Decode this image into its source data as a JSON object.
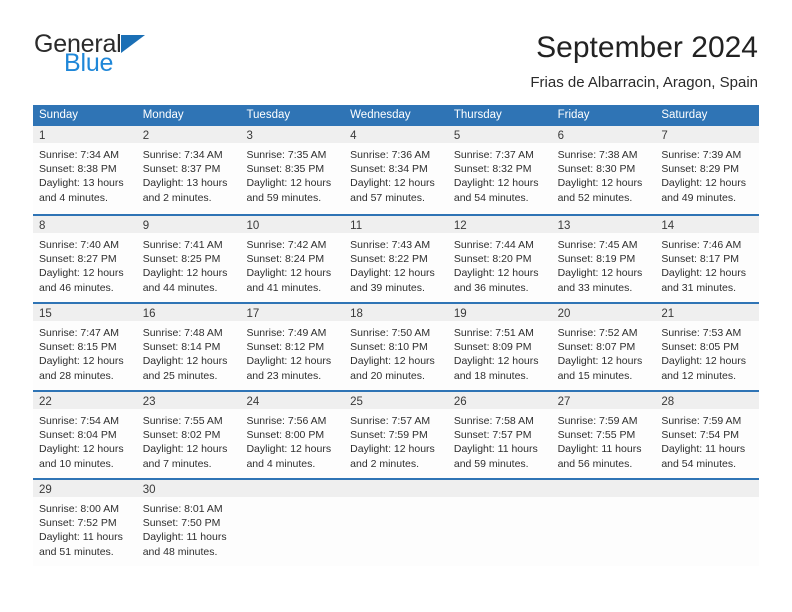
{
  "brand": {
    "name_primary": "General",
    "name_secondary": "Blue",
    "triangle_icon": "triangle-icon",
    "accent_color": "#1f87d8"
  },
  "header": {
    "title": "September 2024",
    "location": "Frias de Albarracin, Aragon, Spain"
  },
  "theme": {
    "header_blue": "#2f74b5",
    "daynum_band": "#efefef",
    "text": "#2e2e2e"
  },
  "calendar": {
    "weekday_headers": [
      "Sunday",
      "Monday",
      "Tuesday",
      "Wednesday",
      "Thursday",
      "Friday",
      "Saturday"
    ],
    "weeks": [
      [
        {
          "day": "1",
          "sunrise": "Sunrise: 7:34 AM",
          "sunset": "Sunset: 8:38 PM",
          "daylight_line1": "Daylight: 13 hours",
          "daylight_line2": "and 4 minutes."
        },
        {
          "day": "2",
          "sunrise": "Sunrise: 7:34 AM",
          "sunset": "Sunset: 8:37 PM",
          "daylight_line1": "Daylight: 13 hours",
          "daylight_line2": "and 2 minutes."
        },
        {
          "day": "3",
          "sunrise": "Sunrise: 7:35 AM",
          "sunset": "Sunset: 8:35 PM",
          "daylight_line1": "Daylight: 12 hours",
          "daylight_line2": "and 59 minutes."
        },
        {
          "day": "4",
          "sunrise": "Sunrise: 7:36 AM",
          "sunset": "Sunset: 8:34 PM",
          "daylight_line1": "Daylight: 12 hours",
          "daylight_line2": "and 57 minutes."
        },
        {
          "day": "5",
          "sunrise": "Sunrise: 7:37 AM",
          "sunset": "Sunset: 8:32 PM",
          "daylight_line1": "Daylight: 12 hours",
          "daylight_line2": "and 54 minutes."
        },
        {
          "day": "6",
          "sunrise": "Sunrise: 7:38 AM",
          "sunset": "Sunset: 8:30 PM",
          "daylight_line1": "Daylight: 12 hours",
          "daylight_line2": "and 52 minutes."
        },
        {
          "day": "7",
          "sunrise": "Sunrise: 7:39 AM",
          "sunset": "Sunset: 8:29 PM",
          "daylight_line1": "Daylight: 12 hours",
          "daylight_line2": "and 49 minutes."
        }
      ],
      [
        {
          "day": "8",
          "sunrise": "Sunrise: 7:40 AM",
          "sunset": "Sunset: 8:27 PM",
          "daylight_line1": "Daylight: 12 hours",
          "daylight_line2": "and 46 minutes."
        },
        {
          "day": "9",
          "sunrise": "Sunrise: 7:41 AM",
          "sunset": "Sunset: 8:25 PM",
          "daylight_line1": "Daylight: 12 hours",
          "daylight_line2": "and 44 minutes."
        },
        {
          "day": "10",
          "sunrise": "Sunrise: 7:42 AM",
          "sunset": "Sunset: 8:24 PM",
          "daylight_line1": "Daylight: 12 hours",
          "daylight_line2": "and 41 minutes."
        },
        {
          "day": "11",
          "sunrise": "Sunrise: 7:43 AM",
          "sunset": "Sunset: 8:22 PM",
          "daylight_line1": "Daylight: 12 hours",
          "daylight_line2": "and 39 minutes."
        },
        {
          "day": "12",
          "sunrise": "Sunrise: 7:44 AM",
          "sunset": "Sunset: 8:20 PM",
          "daylight_line1": "Daylight: 12 hours",
          "daylight_line2": "and 36 minutes."
        },
        {
          "day": "13",
          "sunrise": "Sunrise: 7:45 AM",
          "sunset": "Sunset: 8:19 PM",
          "daylight_line1": "Daylight: 12 hours",
          "daylight_line2": "and 33 minutes."
        },
        {
          "day": "14",
          "sunrise": "Sunrise: 7:46 AM",
          "sunset": "Sunset: 8:17 PM",
          "daylight_line1": "Daylight: 12 hours",
          "daylight_line2": "and 31 minutes."
        }
      ],
      [
        {
          "day": "15",
          "sunrise": "Sunrise: 7:47 AM",
          "sunset": "Sunset: 8:15 PM",
          "daylight_line1": "Daylight: 12 hours",
          "daylight_line2": "and 28 minutes."
        },
        {
          "day": "16",
          "sunrise": "Sunrise: 7:48 AM",
          "sunset": "Sunset: 8:14 PM",
          "daylight_line1": "Daylight: 12 hours",
          "daylight_line2": "and 25 minutes."
        },
        {
          "day": "17",
          "sunrise": "Sunrise: 7:49 AM",
          "sunset": "Sunset: 8:12 PM",
          "daylight_line1": "Daylight: 12 hours",
          "daylight_line2": "and 23 minutes."
        },
        {
          "day": "18",
          "sunrise": "Sunrise: 7:50 AM",
          "sunset": "Sunset: 8:10 PM",
          "daylight_line1": "Daylight: 12 hours",
          "daylight_line2": "and 20 minutes."
        },
        {
          "day": "19",
          "sunrise": "Sunrise: 7:51 AM",
          "sunset": "Sunset: 8:09 PM",
          "daylight_line1": "Daylight: 12 hours",
          "daylight_line2": "and 18 minutes."
        },
        {
          "day": "20",
          "sunrise": "Sunrise: 7:52 AM",
          "sunset": "Sunset: 8:07 PM",
          "daylight_line1": "Daylight: 12 hours",
          "daylight_line2": "and 15 minutes."
        },
        {
          "day": "21",
          "sunrise": "Sunrise: 7:53 AM",
          "sunset": "Sunset: 8:05 PM",
          "daylight_line1": "Daylight: 12 hours",
          "daylight_line2": "and 12 minutes."
        }
      ],
      [
        {
          "day": "22",
          "sunrise": "Sunrise: 7:54 AM",
          "sunset": "Sunset: 8:04 PM",
          "daylight_line1": "Daylight: 12 hours",
          "daylight_line2": "and 10 minutes."
        },
        {
          "day": "23",
          "sunrise": "Sunrise: 7:55 AM",
          "sunset": "Sunset: 8:02 PM",
          "daylight_line1": "Daylight: 12 hours",
          "daylight_line2": "and 7 minutes."
        },
        {
          "day": "24",
          "sunrise": "Sunrise: 7:56 AM",
          "sunset": "Sunset: 8:00 PM",
          "daylight_line1": "Daylight: 12 hours",
          "daylight_line2": "and 4 minutes."
        },
        {
          "day": "25",
          "sunrise": "Sunrise: 7:57 AM",
          "sunset": "Sunset: 7:59 PM",
          "daylight_line1": "Daylight: 12 hours",
          "daylight_line2": "and 2 minutes."
        },
        {
          "day": "26",
          "sunrise": "Sunrise: 7:58 AM",
          "sunset": "Sunset: 7:57 PM",
          "daylight_line1": "Daylight: 11 hours",
          "daylight_line2": "and 59 minutes."
        },
        {
          "day": "27",
          "sunrise": "Sunrise: 7:59 AM",
          "sunset": "Sunset: 7:55 PM",
          "daylight_line1": "Daylight: 11 hours",
          "daylight_line2": "and 56 minutes."
        },
        {
          "day": "28",
          "sunrise": "Sunrise: 7:59 AM",
          "sunset": "Sunset: 7:54 PM",
          "daylight_line1": "Daylight: 11 hours",
          "daylight_line2": "and 54 minutes."
        }
      ],
      [
        {
          "day": "29",
          "sunrise": "Sunrise: 8:00 AM",
          "sunset": "Sunset: 7:52 PM",
          "daylight_line1": "Daylight: 11 hours",
          "daylight_line2": "and 51 minutes."
        },
        {
          "day": "30",
          "sunrise": "Sunrise: 8:01 AM",
          "sunset": "Sunset: 7:50 PM",
          "daylight_line1": "Daylight: 11 hours",
          "daylight_line2": "and 48 minutes."
        },
        {
          "day": "",
          "sunrise": "",
          "sunset": "",
          "daylight_line1": "",
          "daylight_line2": ""
        },
        {
          "day": "",
          "sunrise": "",
          "sunset": "",
          "daylight_line1": "",
          "daylight_line2": ""
        },
        {
          "day": "",
          "sunrise": "",
          "sunset": "",
          "daylight_line1": "",
          "daylight_line2": ""
        },
        {
          "day": "",
          "sunrise": "",
          "sunset": "",
          "daylight_line1": "",
          "daylight_line2": ""
        },
        {
          "day": "",
          "sunrise": "",
          "sunset": "",
          "daylight_line1": "",
          "daylight_line2": ""
        }
      ]
    ]
  }
}
